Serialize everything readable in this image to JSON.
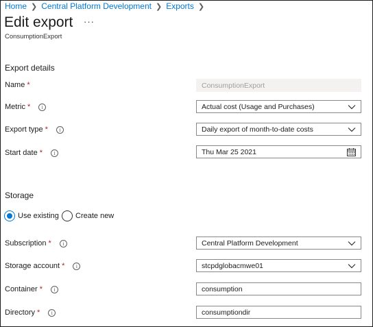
{
  "breadcrumbs": [
    "Home",
    "Central Platform Development",
    "Exports"
  ],
  "page": {
    "title": "Edit export",
    "more_label": "···",
    "subtitle": "ConsumptionExport"
  },
  "export_details": {
    "heading": "Export details",
    "required_mark": "*",
    "info_glyph": "i",
    "name": {
      "label": "Name",
      "value": "ConsumptionExport"
    },
    "metric": {
      "label": "Metric",
      "value": "Actual cost (Usage and Purchases)"
    },
    "export_type": {
      "label": "Export type",
      "value": "Daily export of month-to-date costs"
    },
    "start_date": {
      "label": "Start date",
      "value": "Thu Mar 25 2021"
    }
  },
  "storage": {
    "heading": "Storage",
    "options": [
      {
        "label": "Use existing",
        "selected": true
      },
      {
        "label": "Create new",
        "selected": false
      }
    ],
    "subscription": {
      "label": "Subscription",
      "value": "Central Platform Development"
    },
    "storage_account": {
      "label": "Storage account",
      "value": "stcpdglobacmwe01"
    },
    "container": {
      "label": "Container",
      "value": "consumption"
    },
    "directory": {
      "label": "Directory",
      "value": "consumptiondir"
    }
  },
  "colors": {
    "accent": "#0078d4",
    "required": "#a4262c",
    "disabled_bg": "#f3f2f1"
  },
  "icons": {
    "breadcrumb_separator": "chevron-right-icon",
    "info": "info-icon",
    "dropdown": "chevron-down-icon",
    "date_picker": "calendar-icon",
    "more": "more-icon"
  }
}
